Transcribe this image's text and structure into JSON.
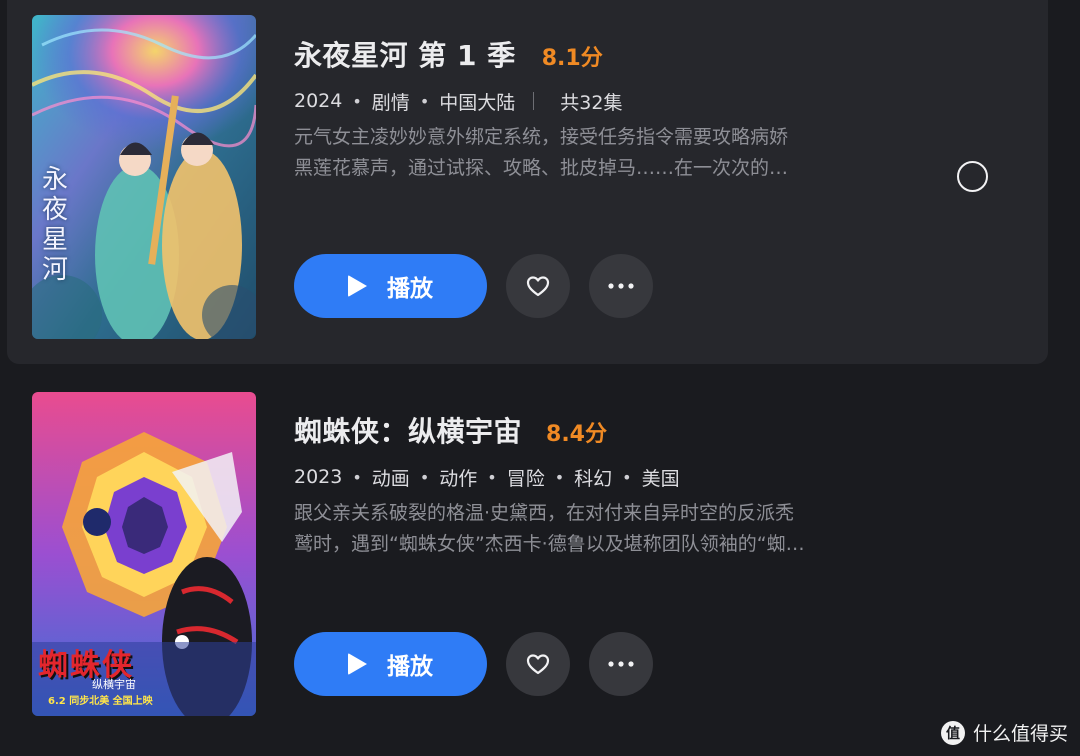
{
  "shows": [
    {
      "title": "永夜星河 第 1 季",
      "score": "8.1分",
      "year": "2024",
      "genres": [
        "剧情",
        "中国大陆"
      ],
      "episodes": "共32集",
      "desc_line1": "元气女主凌妙妙意外绑定系统，接受任务指令需要攻略病娇",
      "desc_line2": "黑莲花慕声，通过试探、攻略、批皮掉马……在一次次的…",
      "poster_text": "永夜星河",
      "play_label": "播放"
    },
    {
      "title": "蜘蛛侠：纵横宇宙",
      "score": "8.4分",
      "year": "2023",
      "genres": [
        "动画",
        "动作",
        "冒险",
        "科幻",
        "美国"
      ],
      "desc_line1": "跟父亲关系破裂的格温·史黛西，在对付来自异时空的反派秃",
      "desc_line2": "鹫时，遇到“蜘蛛女侠”杰西卡·德鲁以及堪称团队领袖的“蜘…",
      "poster_text": "蜘蛛侠",
      "poster_subtext": "纵横宇宙",
      "poster_date": "6.2 同步北美 全国上映",
      "play_label": "播放"
    }
  ],
  "watermark": {
    "icon": "值",
    "text": "什么值得买"
  },
  "colors": {
    "background": "#1a1b1f",
    "card_highlight": "#26272c",
    "play_button": "#2f7cf6",
    "score": "#f08a24",
    "round_button": "#37383d"
  },
  "icons": [
    "play-icon",
    "heart-icon",
    "more-icon",
    "select-circle-icon"
  ]
}
